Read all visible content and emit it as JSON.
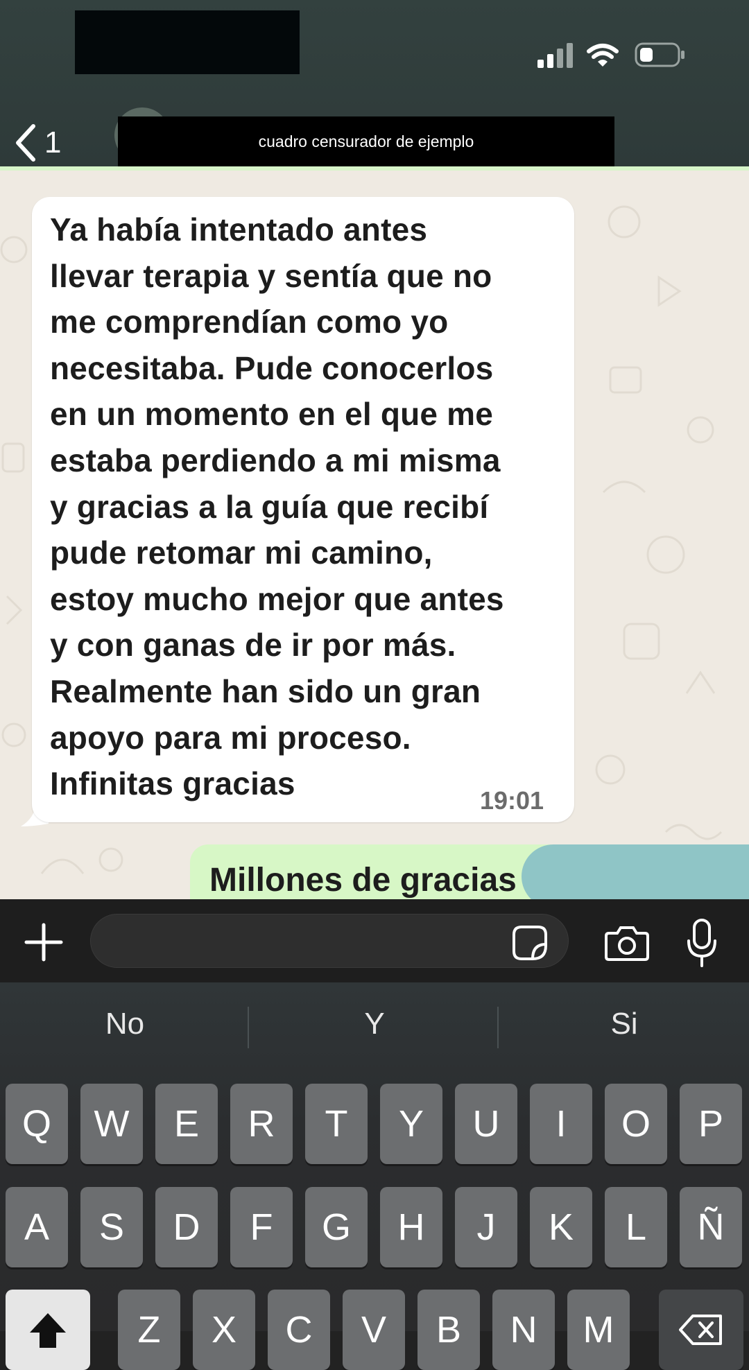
{
  "header": {
    "back_count": "1",
    "censor_text": "cuadro censurador de ejemplo"
  },
  "chat": {
    "incoming": {
      "lines": [
        "Ya había intentado antes",
        "llevar terapia y sentía que no",
        "me comprendían como yo",
        "necesitaba. Pude conocerlos",
        "en un momento en el que me",
        "estaba perdiendo a mi misma",
        "y gracias a la guía que recibí",
        "pude retomar mi camino,",
        "estoy mucho mejor que antes",
        "y con ganas de ir por más.",
        "Realmente han sido un gran",
        "apoyo para mi proceso.",
        "Infinitas gracias"
      ],
      "time": "19:01"
    },
    "outgoing": {
      "text": "Millones de gracias"
    }
  },
  "input": {
    "placeholder": "",
    "value": ""
  },
  "keyboard": {
    "suggestions": [
      "No",
      "Y",
      "Si"
    ],
    "row1": [
      "Q",
      "W",
      "E",
      "R",
      "T",
      "Y",
      "U",
      "I",
      "O",
      "P"
    ],
    "row2": [
      "A",
      "S",
      "D",
      "F",
      "G",
      "H",
      "J",
      "K",
      "L",
      "Ñ"
    ],
    "row3": [
      "Z",
      "X",
      "C",
      "V",
      "B",
      "N",
      "M"
    ]
  },
  "colors": {
    "header_bg": "#33413f",
    "incoming_bubble": "#ffffff",
    "outgoing_bubble": "#d7f7c6",
    "chat_bg": "#efeae2",
    "key_bg": "#6c6e70"
  },
  "icons": {
    "status": [
      "signal-icon",
      "wifi-icon",
      "battery-icon"
    ],
    "input_bar": [
      "plus-icon",
      "sticker-icon",
      "camera-icon",
      "microphone-icon"
    ],
    "keyboard": [
      "shift-icon",
      "backspace-icon"
    ]
  }
}
